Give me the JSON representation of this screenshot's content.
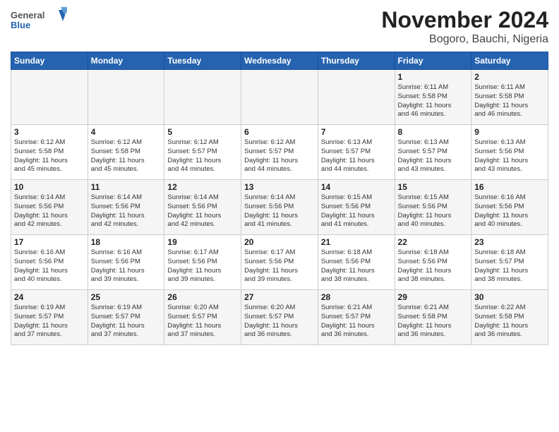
{
  "header": {
    "logo": {
      "general": "General",
      "blue": "Blue"
    },
    "title": "November 2024",
    "location": "Bogoro, Bauchi, Nigeria"
  },
  "columns": [
    "Sunday",
    "Monday",
    "Tuesday",
    "Wednesday",
    "Thursday",
    "Friday",
    "Saturday"
  ],
  "weeks": [
    {
      "row_bg": "light",
      "days": [
        {
          "num": "",
          "info": ""
        },
        {
          "num": "",
          "info": ""
        },
        {
          "num": "",
          "info": ""
        },
        {
          "num": "",
          "info": ""
        },
        {
          "num": "",
          "info": ""
        },
        {
          "num": "1",
          "info": "Sunrise: 6:11 AM\nSunset: 5:58 PM\nDaylight: 11 hours\nand 46 minutes."
        },
        {
          "num": "2",
          "info": "Sunrise: 6:11 AM\nSunset: 5:58 PM\nDaylight: 11 hours\nand 46 minutes."
        }
      ]
    },
    {
      "row_bg": "dark",
      "days": [
        {
          "num": "3",
          "info": "Sunrise: 6:12 AM\nSunset: 5:58 PM\nDaylight: 11 hours\nand 45 minutes."
        },
        {
          "num": "4",
          "info": "Sunrise: 6:12 AM\nSunset: 5:58 PM\nDaylight: 11 hours\nand 45 minutes."
        },
        {
          "num": "5",
          "info": "Sunrise: 6:12 AM\nSunset: 5:57 PM\nDaylight: 11 hours\nand 44 minutes."
        },
        {
          "num": "6",
          "info": "Sunrise: 6:12 AM\nSunset: 5:57 PM\nDaylight: 11 hours\nand 44 minutes."
        },
        {
          "num": "7",
          "info": "Sunrise: 6:13 AM\nSunset: 5:57 PM\nDaylight: 11 hours\nand 44 minutes."
        },
        {
          "num": "8",
          "info": "Sunrise: 6:13 AM\nSunset: 5:57 PM\nDaylight: 11 hours\nand 43 minutes."
        },
        {
          "num": "9",
          "info": "Sunrise: 6:13 AM\nSunset: 5:56 PM\nDaylight: 11 hours\nand 43 minutes."
        }
      ]
    },
    {
      "row_bg": "light",
      "days": [
        {
          "num": "10",
          "info": "Sunrise: 6:14 AM\nSunset: 5:56 PM\nDaylight: 11 hours\nand 42 minutes."
        },
        {
          "num": "11",
          "info": "Sunrise: 6:14 AM\nSunset: 5:56 PM\nDaylight: 11 hours\nand 42 minutes."
        },
        {
          "num": "12",
          "info": "Sunrise: 6:14 AM\nSunset: 5:56 PM\nDaylight: 11 hours\nand 42 minutes."
        },
        {
          "num": "13",
          "info": "Sunrise: 6:14 AM\nSunset: 5:56 PM\nDaylight: 11 hours\nand 41 minutes."
        },
        {
          "num": "14",
          "info": "Sunrise: 6:15 AM\nSunset: 5:56 PM\nDaylight: 11 hours\nand 41 minutes."
        },
        {
          "num": "15",
          "info": "Sunrise: 6:15 AM\nSunset: 5:56 PM\nDaylight: 11 hours\nand 40 minutes."
        },
        {
          "num": "16",
          "info": "Sunrise: 6:16 AM\nSunset: 5:56 PM\nDaylight: 11 hours\nand 40 minutes."
        }
      ]
    },
    {
      "row_bg": "dark",
      "days": [
        {
          "num": "17",
          "info": "Sunrise: 6:16 AM\nSunset: 5:56 PM\nDaylight: 11 hours\nand 40 minutes."
        },
        {
          "num": "18",
          "info": "Sunrise: 6:16 AM\nSunset: 5:56 PM\nDaylight: 11 hours\nand 39 minutes."
        },
        {
          "num": "19",
          "info": "Sunrise: 6:17 AM\nSunset: 5:56 PM\nDaylight: 11 hours\nand 39 minutes."
        },
        {
          "num": "20",
          "info": "Sunrise: 6:17 AM\nSunset: 5:56 PM\nDaylight: 11 hours\nand 39 minutes."
        },
        {
          "num": "21",
          "info": "Sunrise: 6:18 AM\nSunset: 5:56 PM\nDaylight: 11 hours\nand 38 minutes."
        },
        {
          "num": "22",
          "info": "Sunrise: 6:18 AM\nSunset: 5:56 PM\nDaylight: 11 hours\nand 38 minutes."
        },
        {
          "num": "23",
          "info": "Sunrise: 6:18 AM\nSunset: 5:57 PM\nDaylight: 11 hours\nand 38 minutes."
        }
      ]
    },
    {
      "row_bg": "light",
      "days": [
        {
          "num": "24",
          "info": "Sunrise: 6:19 AM\nSunset: 5:57 PM\nDaylight: 11 hours\nand 37 minutes."
        },
        {
          "num": "25",
          "info": "Sunrise: 6:19 AM\nSunset: 5:57 PM\nDaylight: 11 hours\nand 37 minutes."
        },
        {
          "num": "26",
          "info": "Sunrise: 6:20 AM\nSunset: 5:57 PM\nDaylight: 11 hours\nand 37 minutes."
        },
        {
          "num": "27",
          "info": "Sunrise: 6:20 AM\nSunset: 5:57 PM\nDaylight: 11 hours\nand 36 minutes."
        },
        {
          "num": "28",
          "info": "Sunrise: 6:21 AM\nSunset: 5:57 PM\nDaylight: 11 hours\nand 36 minutes."
        },
        {
          "num": "29",
          "info": "Sunrise: 6:21 AM\nSunset: 5:58 PM\nDaylight: 11 hours\nand 36 minutes."
        },
        {
          "num": "30",
          "info": "Sunrise: 6:22 AM\nSunset: 5:58 PM\nDaylight: 11 hours\nand 36 minutes."
        }
      ]
    }
  ]
}
